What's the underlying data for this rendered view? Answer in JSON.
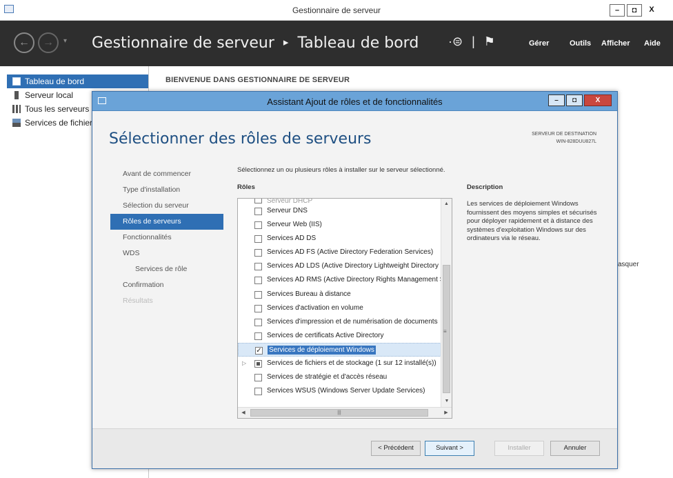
{
  "window": {
    "title": "Gestionnaire de serveur",
    "controls": {
      "minimize": "–",
      "maximize": "◘",
      "close": "X"
    }
  },
  "header": {
    "breadcrumb_root": "Gestionnaire de serveur",
    "breadcrumb_separator": "▸",
    "breadcrumb_current": "Tableau de bord",
    "menu": [
      "Gérer",
      "Outils",
      "Afficher",
      "Aide"
    ]
  },
  "sidebar": {
    "items": [
      {
        "label": "Tableau de bord",
        "icon": "dashboard-icon"
      },
      {
        "label": "Serveur local",
        "icon": "server-icon"
      },
      {
        "label": "Tous les serveurs",
        "icon": "servers-icon"
      },
      {
        "label": "Services de fichiers",
        "icon": "file-services-icon"
      }
    ]
  },
  "main": {
    "welcome_title": "BIENVENUE DANS GESTIONNAIRE DE SERVEUR",
    "right_fragment": "asquer"
  },
  "wizard": {
    "title": "Assistant Ajout de rôles et de fonctionnalités",
    "heading": "Sélectionner des rôles de serveurs",
    "destination_label": "SERVEUR DE DESTINATION",
    "destination_server": "WIN-828DUU827L",
    "steps": [
      {
        "label": "Avant de commencer"
      },
      {
        "label": "Type d'installation"
      },
      {
        "label": "Sélection du serveur"
      },
      {
        "label": "Rôles de serveurs"
      },
      {
        "label": "Fonctionnalités"
      },
      {
        "label": "WDS"
      },
      {
        "label": "Services de rôle"
      },
      {
        "label": "Confirmation"
      },
      {
        "label": "Résultats"
      }
    ],
    "instruction": "Sélectionnez un ou plusieurs rôles à installer sur le serveur sélectionné.",
    "roles_label": "Rôles",
    "roles": [
      {
        "label": "Serveur DHCP",
        "checked": false
      },
      {
        "label": "Serveur DNS",
        "checked": false
      },
      {
        "label": "Serveur Web (IIS)",
        "checked": false
      },
      {
        "label": "Services AD DS",
        "checked": false
      },
      {
        "label": "Services AD FS (Active Directory Federation Services)",
        "checked": false
      },
      {
        "label": "Services AD LDS (Active Directory Lightweight Directory Services)",
        "checked": false
      },
      {
        "label": "Services AD RMS (Active Directory Rights Management Services)",
        "checked": false
      },
      {
        "label": "Services Bureau à distance",
        "checked": false
      },
      {
        "label": "Services d'activation en volume",
        "checked": false
      },
      {
        "label": "Services d'impression et de numérisation de documents",
        "checked": false
      },
      {
        "label": "Services de certificats Active Directory",
        "checked": false
      },
      {
        "label": "Services de déploiement Windows",
        "checked": true
      },
      {
        "label": "Services de fichiers et de stockage (1 sur 12 installé(s))",
        "checked": false
      },
      {
        "label": "Services de stratégie et d'accès réseau",
        "checked": false
      },
      {
        "label": "Services WSUS (Windows Server Update Services)",
        "checked": false
      }
    ],
    "description_label": "Description",
    "description_text": "Les services de déploiement Windows fournissent des moyens simples et sécurisés pour déployer rapidement et à distance des systèmes d'exploitation Windows sur des ordinateurs via le réseau.",
    "buttons": {
      "previous": "< Précédent",
      "next": "Suivant >",
      "install": "Installer",
      "cancel": "Annuler"
    }
  }
}
